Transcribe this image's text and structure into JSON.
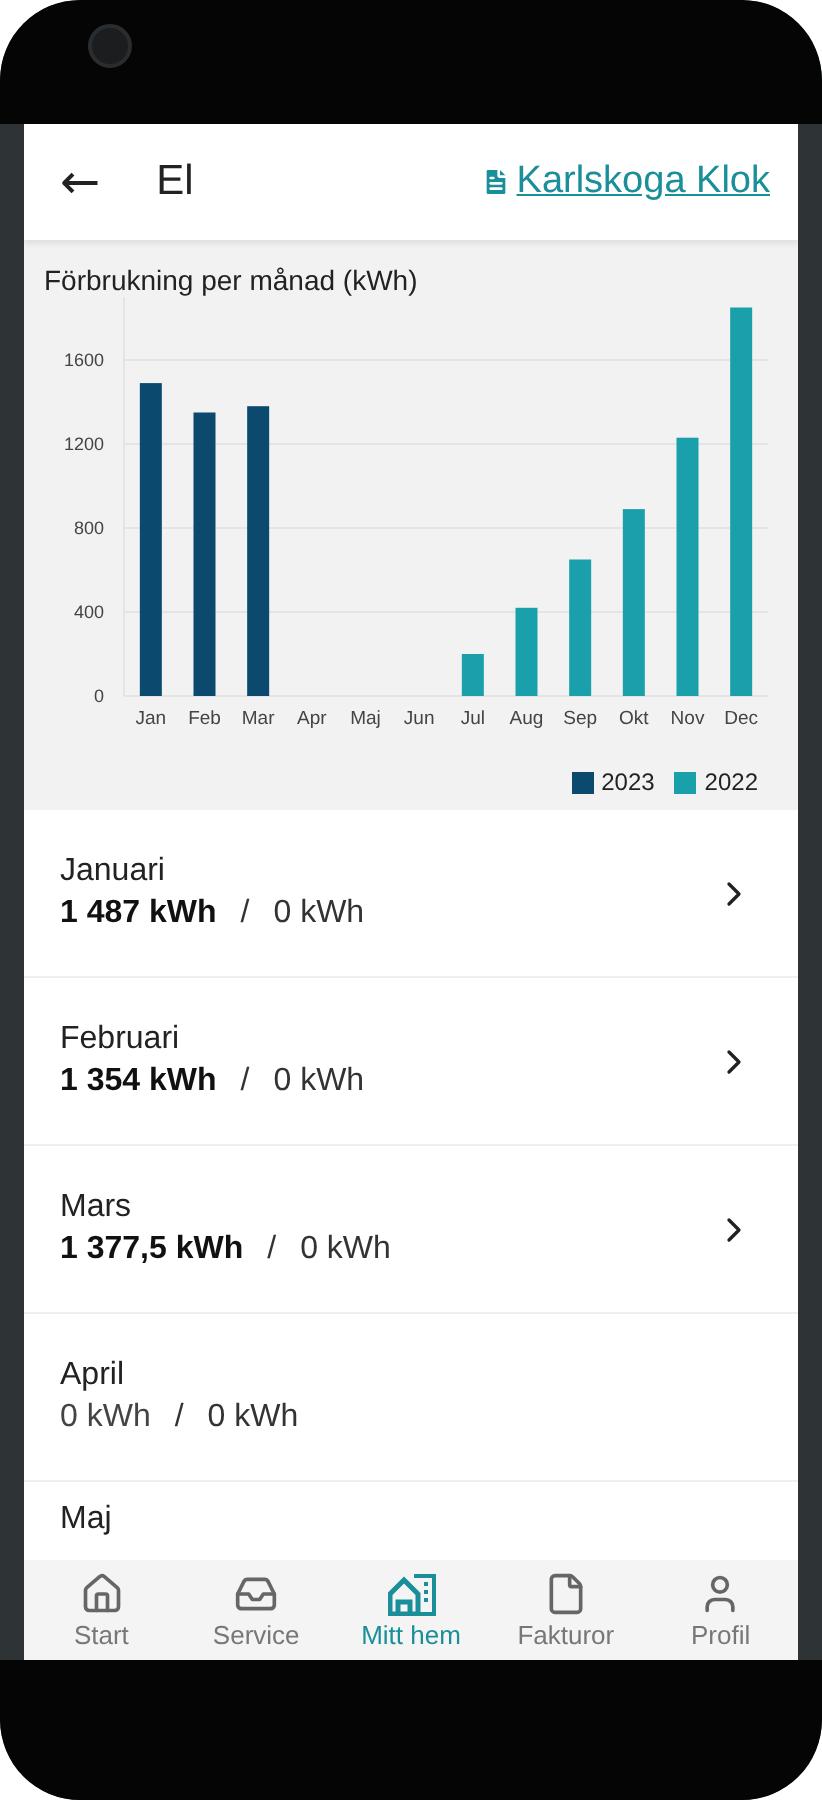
{
  "header": {
    "back": "←",
    "title": "El",
    "link": "Karlskoga Klok"
  },
  "chart": {
    "title": "Förbrukning per månad (kWh)",
    "chart_data": {
      "type": "bar",
      "categories": [
        "Jan",
        "Feb",
        "Mar",
        "Apr",
        "Maj",
        "Jun",
        "Jul",
        "Aug",
        "Sep",
        "Okt",
        "Nov",
        "Dec"
      ],
      "series": [
        {
          "name": "2023",
          "color": "#0b4a6e",
          "values": [
            1490,
            1350,
            1380,
            null,
            null,
            null,
            null,
            null,
            null,
            null,
            null,
            null
          ]
        },
        {
          "name": "2022",
          "color": "#1aa0aa",
          "values": [
            null,
            null,
            null,
            null,
            null,
            null,
            200,
            420,
            650,
            890,
            1230,
            1850
          ]
        }
      ],
      "ylim": [
        0,
        1900
      ],
      "yticks": [
        0,
        400,
        800,
        1200,
        1600
      ],
      "grid": true
    }
  },
  "months": [
    {
      "name": "Januari",
      "current": "1 487 kWh",
      "separator": "/",
      "previous": "0 kWh",
      "has_data": true
    },
    {
      "name": "Februari",
      "current": "1 354 kWh",
      "separator": "/",
      "previous": "0 kWh",
      "has_data": true
    },
    {
      "name": "Mars",
      "current": "1 377,5 kWh",
      "separator": "/",
      "previous": "0 kWh",
      "has_data": true
    },
    {
      "name": "April",
      "current": "0 kWh",
      "separator": "/",
      "previous": "0 kWh",
      "has_data": false
    },
    {
      "name": "Maj"
    }
  ],
  "nav": [
    {
      "label": "Start",
      "selected": false
    },
    {
      "label": "Service",
      "selected": false
    },
    {
      "label": "Mitt hem",
      "selected": true
    },
    {
      "label": "Fakturor",
      "selected": false
    },
    {
      "label": "Profil",
      "selected": false
    }
  ]
}
